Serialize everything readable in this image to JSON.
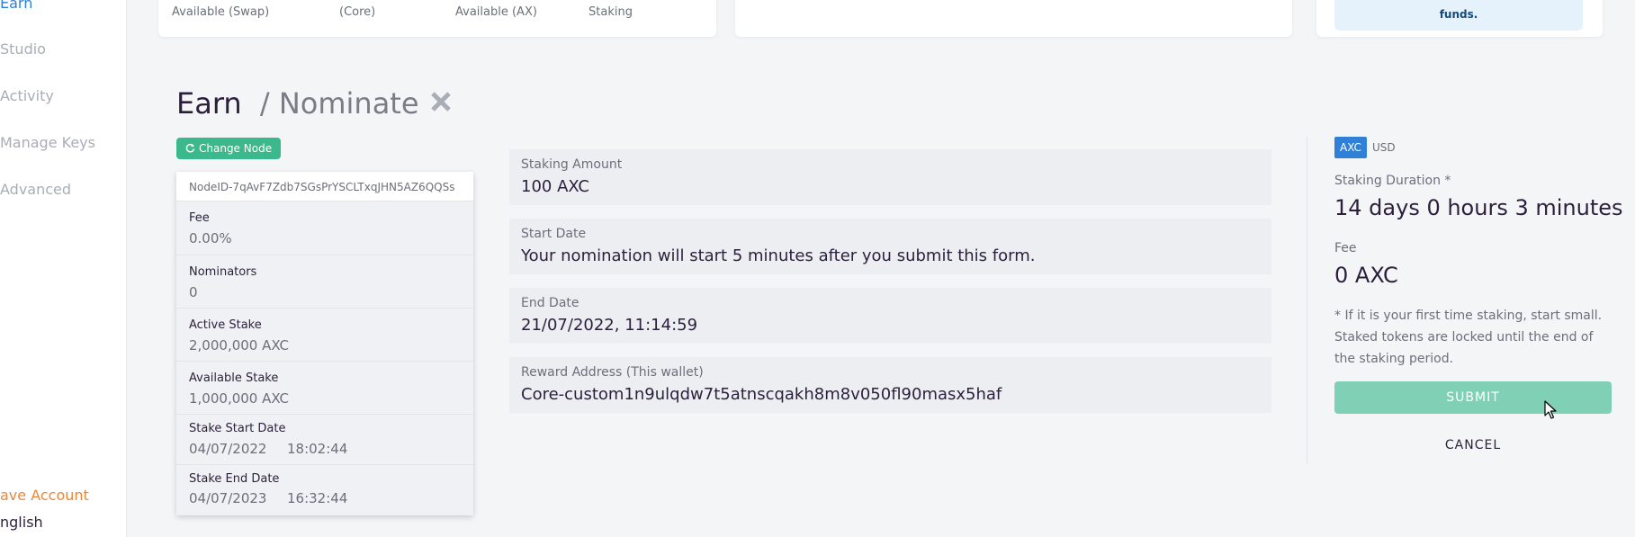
{
  "sidebar": {
    "items": [
      {
        "label": "Earn",
        "active": true
      },
      {
        "label": "Studio",
        "active": false
      },
      {
        "label": "Activity",
        "active": false
      },
      {
        "label": "Manage Keys",
        "active": false
      },
      {
        "label": "Advanced",
        "active": false
      }
    ],
    "save_account": "ave Account",
    "language": "nglish"
  },
  "top_cards": {
    "card1_labels": [
      "Available (Swap)",
      "(Core)",
      "Available (AX)",
      "Staking"
    ],
    "swap_note": "funds."
  },
  "header": {
    "title": "Earn",
    "subtitle": "/ Nominate"
  },
  "change_node": "Change Node",
  "node_card": {
    "node_id": "NodeID-7qAvF7Zdb7SGsPrYSCLTxqJHN5AZ6QQSs",
    "fee": {
      "label": "Fee",
      "value": "0.00%"
    },
    "nominators": {
      "label": "Nominators",
      "value": "0"
    },
    "active_stake": {
      "label": "Active Stake",
      "value": "2,000,000 AXC"
    },
    "available_stake": {
      "label": "Available Stake",
      "value": "1,000,000 AXC"
    },
    "stake_start": {
      "label": "Stake Start Date",
      "date": "04/07/2022",
      "time": "18:02:44"
    },
    "stake_end": {
      "label": "Stake End Date",
      "date": "04/07/2023",
      "time": "16:32:44"
    }
  },
  "form": {
    "staking_amount": {
      "label": "Staking Amount",
      "value": "100 AXC"
    },
    "start_date": {
      "label": "Start Date",
      "value": "Your nomination will start 5 minutes after you submit this form."
    },
    "end_date": {
      "label": "End Date",
      "value": "21/07/2022, 11:14:59"
    },
    "reward_address": {
      "label": "Reward Address (This wallet)",
      "value": "Core-custom1n9ulqdw7t5atnscqakh8m8v050fl90masx5haf"
    }
  },
  "summary": {
    "currency": {
      "selected": "AXC",
      "other": "USD"
    },
    "duration_label": "Staking Duration *",
    "duration_value": "14 days 0 hours 3 minutes",
    "fee_label": "Fee",
    "fee_value": "0 AXC",
    "note": "* If it is your first time staking, start small. Staked tokens are locked until the end of the staking period.",
    "submit": "SUBMIT",
    "cancel": "CANCEL"
  },
  "colors": {
    "accent_blue": "#2f80d6",
    "green": "#3bb98d",
    "submit_disabled": "#7fd0b5",
    "orange": "#e8883a"
  }
}
